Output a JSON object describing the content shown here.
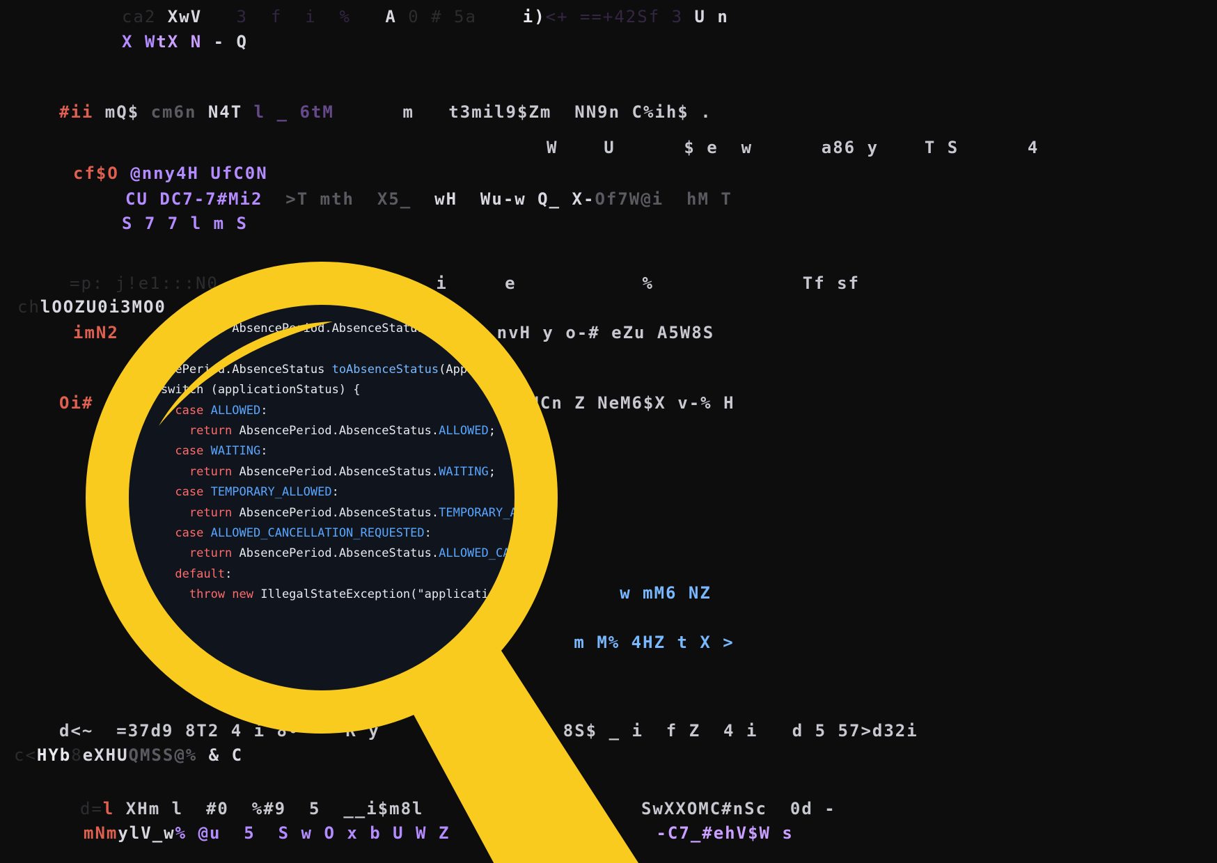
{
  "colors": {
    "background": "#0d0d0e",
    "lens_yellow": "#f9cb1f",
    "lens_inner": "#10141d",
    "keyword": "#ff6b6b",
    "function": "#79b8ff",
    "constant": "#58a6ff",
    "code_text": "#e8eaee"
  },
  "icons": [
    "magnifying-glass-icon"
  ],
  "background_code": [
    {
      "segments": [
        {
          "t": "ca2 ",
          "s": "dim",
          "c": "#9a9aa5"
        },
        {
          "t": "XwV",
          "c": "#d8d8e0"
        },
        {
          "t": "   3  f  i  %   ",
          "s": "dim",
          "c": "#b07af0"
        },
        {
          "t": "A",
          "c": "#d8d8e0"
        },
        {
          "t": " 0 # 5a    ",
          "s": "dim",
          "c": "#9a9aa5"
        },
        {
          "t": "i)",
          "c": "#e8e8ee"
        },
        {
          "t": "<+ ==+42Sf 3 ",
          "s": "dim",
          "c": "#c080ff"
        },
        {
          "t": "U n",
          "c": "#d8d8e0"
        }
      ]
    },
    {
      "segments": [
        {
          "t": "X W",
          "c": "#b48cff"
        },
        {
          "t": "tX N ",
          "c": "#c9a0ff"
        },
        {
          "t": "- Q",
          "c": "#d8d8e0"
        }
      ]
    },
    {
      "segments": [
        {
          "t": "#ii",
          "c": "#e06050"
        },
        {
          "t": " mQ$",
          "c": "#c8c8d0"
        },
        {
          "t": " cm6n ",
          "s": "mid",
          "c": "#9a9aa5"
        },
        {
          "t": "N4T",
          "c": "#d8d8e0"
        },
        {
          "t": " l _ 6tM",
          "s": "mid",
          "c": "#b07af0"
        },
        {
          "t": "      m   t3mil9$Zm  NN9n C%ih$ .",
          "c": "#c8c8d0"
        }
      ]
    },
    {
      "segments": [
        {
          "t": "W    U      $ e  w      a86 y    T S      4",
          "c": "#c8c8d0"
        }
      ]
    },
    {
      "segments": [
        {
          "t": "cf$O",
          "c": "#e06050"
        },
        {
          "t": " @nny4H UfC0N",
          "c": "#b48cff"
        }
      ]
    },
    {
      "segments": [
        {
          "t": "CU DC7-7#Mi2 ",
          "c": "#b48cff"
        },
        {
          "t": " >T mth  X5_ ",
          "s": "mid",
          "c": "#9a9aa5"
        },
        {
          "t": " wH  Wu-w Q_ X-",
          "c": "#d8d8e0"
        },
        {
          "t": "Of7W@i  hM T",
          "s": "mid",
          "c": "#9a9aa5"
        }
      ]
    },
    {
      "segments": [
        {
          "t": "S 7 7 l m S",
          "c": "#b48cff"
        }
      ]
    },
    {
      "segments": [
        {
          "t": "=p: j!e1:::N0",
          "s": "dim",
          "c": "#9a9aa5"
        },
        {
          "t": "              5 s  i     e           %             Tf sf",
          "c": "#c8c8d0"
        }
      ]
    },
    {
      "segments": [
        {
          "t": "ch",
          "s": "dim",
          "c": "#9a9aa5"
        },
        {
          "t": "lOOZU0i3MO0",
          "c": "#d8d8e0"
        }
      ]
    },
    {
      "segments": [
        {
          "t": "imN2",
          "c": "#e06050"
        },
        {
          "t": "                             uv- nvH y o-# eZu A5W8S",
          "c": "#c8c8d0"
        }
      ]
    },
    {
      "segments": [
        {
          "t": "Oi#",
          "c": "#e06050"
        },
        {
          "t": "                                      NCn Z NeM6$X v-% H",
          "c": "#c8c8d0"
        }
      ]
    },
    {
      "segments": [
        {
          "t": "                                             w mM6 NZ",
          "c": "#79b8ff"
        }
      ]
    },
    {
      "segments": [
        {
          "t": "                                         m M% 4HZ t X >",
          "c": "#79b8ff"
        }
      ]
    },
    {
      "segments": [
        {
          "t": "d<~  =37d9 8T2 4 i 8•    R y        09H c t 8S$ _ i  f Z  4 i   d 5 57>d32i",
          "c": "#c8c8d0"
        }
      ]
    },
    {
      "segments": [
        {
          "t": "c<",
          "s": "dim",
          "c": "#9a9aa5"
        },
        {
          "t": "HYb",
          "c": "#e8e8ee"
        },
        {
          "t": "8",
          "s": "dim",
          "c": "#9a9aa5"
        },
        {
          "t": "eXHU",
          "c": "#d8d8e0"
        },
        {
          "t": "QMSS@%",
          "s": "mid",
          "c": "#9a9aa5"
        },
        {
          "t": " & C",
          "c": "#d8d8e0"
        }
      ]
    },
    {
      "segments": [
        {
          "t": "d=",
          "s": "dim",
          "c": "#9a9aa5"
        },
        {
          "t": "l",
          "c": "#e06050"
        },
        {
          "t": " XHm l  #0  %#9  5  __i$m8l                   SwXXOMC#nSc  0d -",
          "c": "#c8c8d0"
        }
      ]
    },
    {
      "segments": [
        {
          "t": "mNm",
          "c": "#e06050"
        },
        {
          "t": "ylV_w",
          "c": "#d8d8e0"
        },
        {
          "t": "% @u  5  S w O x b U W Z",
          "c": "#b48cff"
        },
        {
          "t": "                  -C7_#ehV$W s",
          "c": "#c9a0ff"
        }
      ]
    }
  ],
  "code": {
    "lines": [
      [
        {
          "t": "public static AbsencePeriod.AbsenceStatus ",
          "c": "plain"
        },
        {
          "t": "toAbsencePeriods",
          "c": "fn"
        },
        {
          "t": "(application, asked",
          "c": "plain"
        }
      ],
      [
        {
          "t": "",
          "c": "plain"
        }
      ],
      [
        {
          "t": "AbsencePeriod.AbsenceStatus ",
          "c": "plain"
        },
        {
          "t": "toAbsenceStatus",
          "c": "fn"
        },
        {
          "t": "(ApplicationStatus",
          "c": "plain"
        }
      ],
      [
        {
          "t": "    switch (applicationStatus) {",
          "c": "plain"
        }
      ],
      [
        {
          "t": "      case ",
          "c": "kw"
        },
        {
          "t": "ALLOWED",
          "c": "cn"
        },
        {
          "t": ":",
          "c": "plain"
        }
      ],
      [
        {
          "t": "        return ",
          "c": "kw"
        },
        {
          "t": "AbsencePeriod.AbsenceStatus.",
          "c": "plain"
        },
        {
          "t": "ALLOWED",
          "c": "cn"
        },
        {
          "t": ";",
          "c": "plain"
        }
      ],
      [
        {
          "t": "      case ",
          "c": "kw"
        },
        {
          "t": "WAITING",
          "c": "cn"
        },
        {
          "t": ":",
          "c": "plain"
        }
      ],
      [
        {
          "t": "        return ",
          "c": "kw"
        },
        {
          "t": "AbsencePeriod.AbsenceStatus.",
          "c": "plain"
        },
        {
          "t": "WAITING",
          "c": "cn"
        },
        {
          "t": ";",
          "c": "plain"
        }
      ],
      [
        {
          "t": "      case ",
          "c": "kw"
        },
        {
          "t": "TEMPORARY_ALLOWED",
          "c": "cn"
        },
        {
          "t": ":",
          "c": "plain"
        }
      ],
      [
        {
          "t": "        return ",
          "c": "kw"
        },
        {
          "t": "AbsencePeriod.AbsenceStatus.",
          "c": "plain"
        },
        {
          "t": "TEMPORARY_ALLOWED",
          "c": "cn"
        },
        {
          "t": ";",
          "c": "plain"
        }
      ],
      [
        {
          "t": "      case ",
          "c": "kw"
        },
        {
          "t": "ALLOWED_CANCELLATION_REQUESTED",
          "c": "cn"
        },
        {
          "t": ":",
          "c": "plain"
        }
      ],
      [
        {
          "t": "        return ",
          "c": "kw"
        },
        {
          "t": "AbsencePeriod.AbsenceStatus.",
          "c": "plain"
        },
        {
          "t": "ALLOWED_CANCELLATION_REQUESTED",
          "c": "cn"
        },
        {
          "t": ";",
          "c": "plain"
        }
      ],
      [
        {
          "t": "      default",
          "c": "kw"
        },
        {
          "t": ":",
          "c": "plain"
        }
      ],
      [
        {
          "t": "        throw new ",
          "c": "kw"
        },
        {
          "t": "IllegalStateException(\"application status\");",
          "c": "plain"
        }
      ]
    ]
  }
}
